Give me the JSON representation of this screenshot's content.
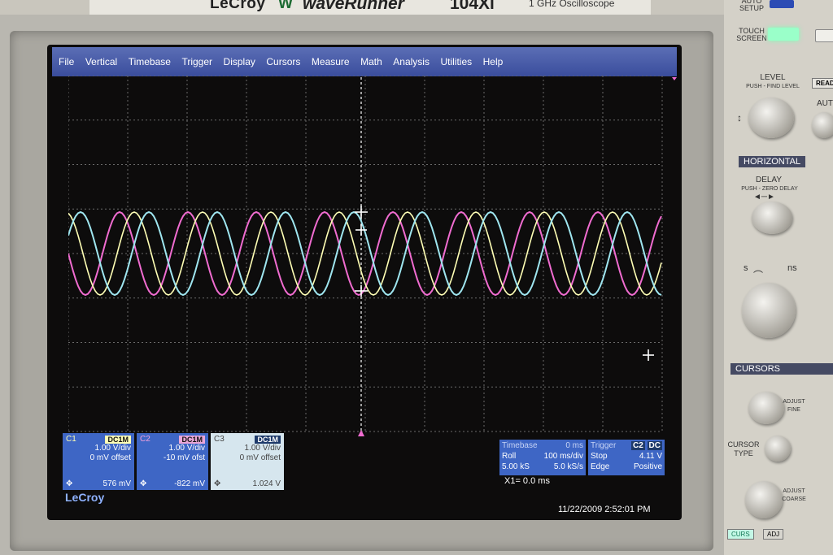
{
  "bezel": {
    "brand": "LeCroy",
    "series": "waveRunner",
    "model": "104Xi",
    "subtitle": "1 GHz Oscilloscope"
  },
  "menu": [
    "File",
    "Vertical",
    "Timebase",
    "Trigger",
    "Display",
    "Cursors",
    "Measure",
    "Math",
    "Analysis",
    "Utilities",
    "Help"
  ],
  "channels": {
    "c1": {
      "name": "C1",
      "coupling": "DC1M",
      "vdiv": "1.00 V/div",
      "offset": "0 mV offset",
      "reading": "576 mV",
      "color": "#ffffb5"
    },
    "c2": {
      "name": "C2",
      "coupling": "DC1M",
      "vdiv": "1.00 V/div",
      "offset": "-10 mV ofst",
      "reading": "-822 mV",
      "color": "#f06cd0"
    },
    "c3": {
      "name": "C3",
      "coupling": "DC1M",
      "vdiv": "1.00 V/div",
      "offset": "0 mV offset",
      "reading": "1.024 V",
      "color": "#9fe6f0"
    }
  },
  "channel_marker": "C3",
  "screen_logo": "LeCroy",
  "timebase": {
    "title": "Timebase",
    "delay": "0 ms",
    "mode": "Roll",
    "tdiv": "100 ms/div",
    "samples": "5.00 kS",
    "rate": "5.0 kS/s"
  },
  "trigger": {
    "title": "Trigger",
    "source": "C2",
    "coupling": "DC",
    "state": "Stop",
    "level": "4.11 V",
    "type": "Edge",
    "slope": "Positive"
  },
  "cursor_readout": "X1= 0.0 ms",
  "timestamp": "11/22/2009 2:52:01 PM",
  "panel": {
    "auto_setup": "AUTO\nSETUP",
    "touch_screen": "TOUCH\nSCREEN",
    "level": "LEVEL",
    "level_hint": "PUSH - FIND LEVEL",
    "ready": "READY",
    "auto": "AUTO",
    "horizontal": "HORIZONTAL",
    "delay": "DELAY",
    "delay_hint": "PUSH - ZERO DELAY",
    "s": "s",
    "ns": "ns",
    "cursors": "CURSORS",
    "adjust_fine": "ADJUST\nFINE",
    "cursor_type": "CURSOR\nTYPE",
    "adjust_coarse": "ADJUST\nCOARSE",
    "curs": "CURS",
    "adj": "ADJ"
  }
}
